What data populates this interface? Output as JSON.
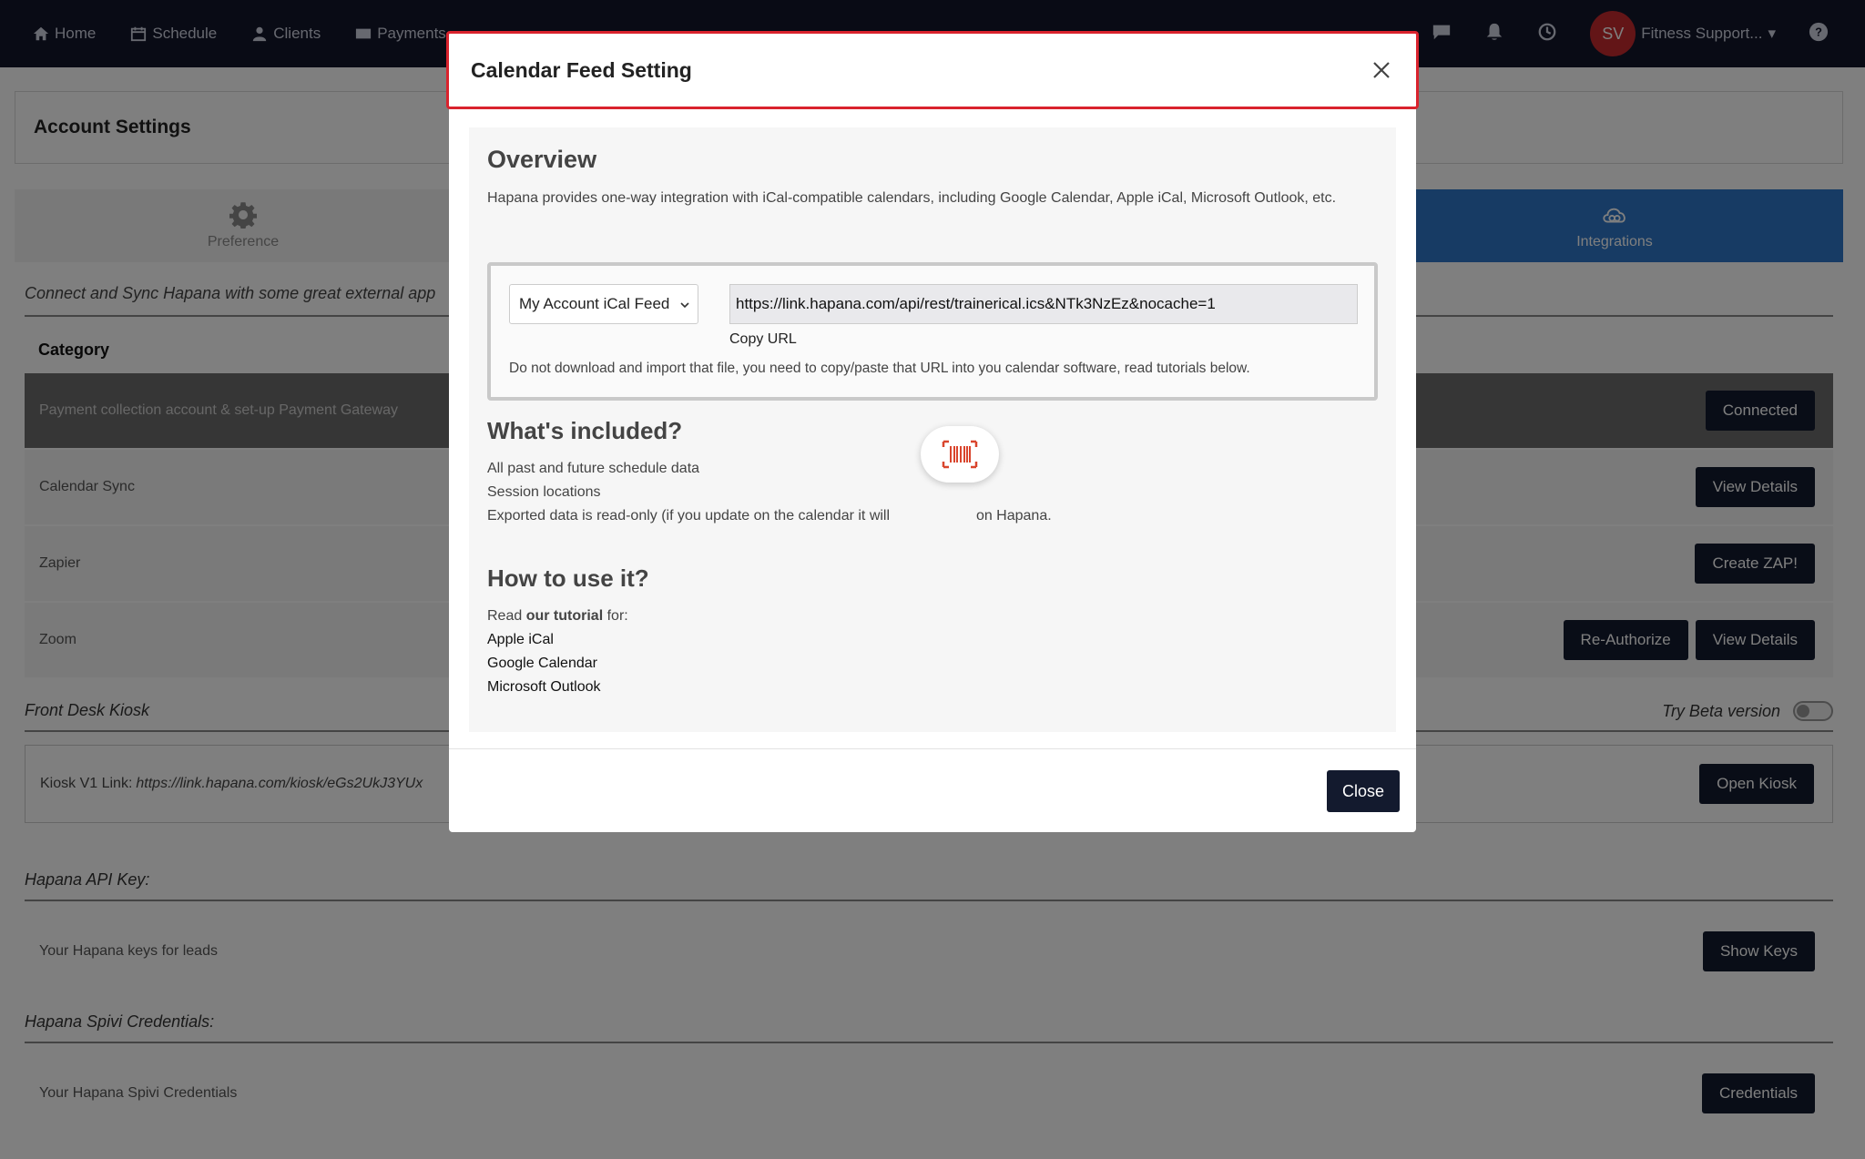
{
  "nav": {
    "items": [
      {
        "label": "Home",
        "icon": "home-icon"
      },
      {
        "label": "Schedule",
        "icon": "calendar-icon"
      },
      {
        "label": "Clients",
        "icon": "user-icon"
      },
      {
        "label": "Payments",
        "icon": "card-icon"
      }
    ],
    "avatar_initials": "SV",
    "user_name": "Fitness Support..."
  },
  "page": {
    "title": "Account Settings",
    "tabs": [
      {
        "label": "Preference"
      },
      {
        "label": "Integrations"
      }
    ],
    "intro": "Connect and Sync Hapana with some great external app",
    "category_title": "Category",
    "rows": [
      {
        "label": "Payment collection account & set-up Payment Gateway",
        "buttons": [
          "Connected"
        ]
      },
      {
        "label": "Calendar Sync",
        "buttons": [
          "View Details"
        ]
      },
      {
        "label": "Zapier",
        "buttons": [
          "Create ZAP!"
        ]
      },
      {
        "label": "Zoom",
        "buttons": [
          "Re-Authorize",
          "View Details"
        ]
      }
    ],
    "kiosk_title": "Front Desk Kiosk",
    "beta_label": "Try Beta version",
    "kiosk_label": "Kiosk V1 Link:",
    "kiosk_link": "https://link.hapana.com/kiosk/eGs2UkJ3YUx",
    "kiosk_button": "Open Kiosk",
    "api_title": "Hapana API Key:",
    "api_label": "Your Hapana keys for leads",
    "api_button": "Show Keys",
    "spivi_title": "Hapana Spivi Credentials:",
    "spivi_label": "Your Hapana Spivi Credentials",
    "spivi_button": "Credentials"
  },
  "modal": {
    "title": "Calendar Feed Setting",
    "overview_title": "Overview",
    "overview_text": "Hapana provides one-way integration with iCal-compatible calendars, including Google Calendar, Apple iCal, Microsoft Outlook, etc.",
    "feed_select": "My Account iCal Feed",
    "feed_url": "https://link.hapana.com/api/rest/trainerical.ics&NTk3NzEz&nocache=1",
    "copy_url": "Copy URL",
    "feed_note": "Do not download and import that file, you need to copy/paste that URL into you calendar software, read tutorials below.",
    "included_title": "What's included?",
    "included_items": [
      "All past and future schedule data",
      "Session locations",
      "Exported data is read-only (if you update on the calendar it will"
    ],
    "included_tail": "on Hapana.",
    "howto_title": "How to use it?",
    "howto_read": "Read",
    "howto_tutorial": "our tutorial",
    "howto_for": "for:",
    "tutorial_links": [
      "Apple iCal",
      "Google Calendar",
      "Microsoft Outlook"
    ],
    "close_button": "Close"
  }
}
